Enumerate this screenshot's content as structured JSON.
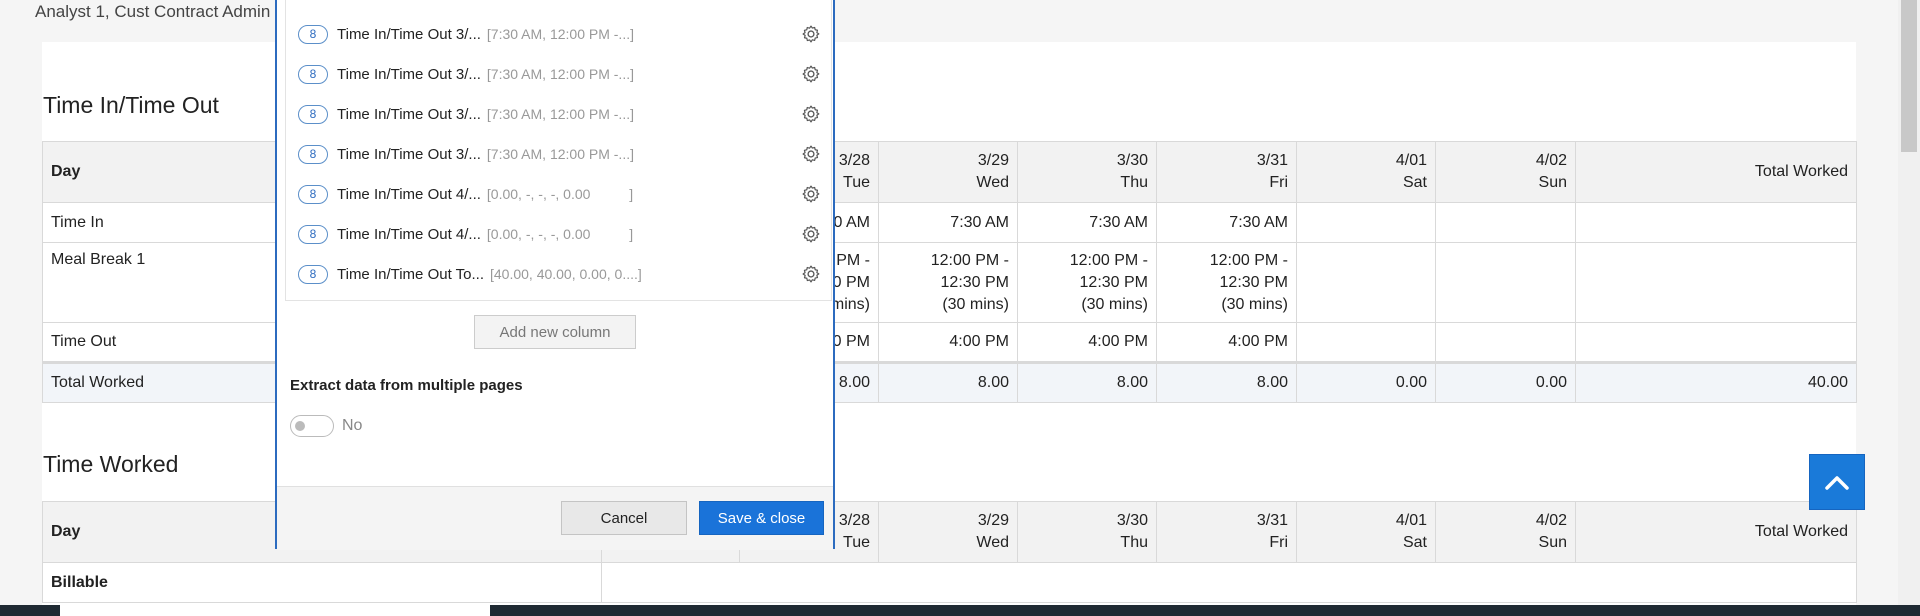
{
  "header": {
    "user_text": "Analyst 1, Cust Contract Admin"
  },
  "time_in_out": {
    "title": "Time In/Time Out",
    "columns": [
      {
        "date": "",
        "day": ""
      },
      {
        "date": "3/28",
        "day": "Tue"
      },
      {
        "date": "3/29",
        "day": "Wed"
      },
      {
        "date": "3/30",
        "day": "Thu"
      },
      {
        "date": "3/31",
        "day": "Fri"
      },
      {
        "date": "4/01",
        "day": "Sat"
      },
      {
        "date": "4/02",
        "day": "Sun"
      }
    ],
    "day_header": "Day",
    "total_header": "Total Worked",
    "rows": {
      "time_in": {
        "label": "Time In",
        "cells": [
          "",
          "0 AM",
          "7:30 AM",
          "7:30 AM",
          "7:30 AM",
          "",
          "",
          ""
        ]
      },
      "meal_break": {
        "label": "Meal Break 1",
        "cells": [
          [
            "",
            "",
            ""
          ],
          [
            "PM -",
            "0 PM",
            "mins)"
          ],
          [
            "12:00 PM -",
            "12:30 PM",
            "(30 mins)"
          ],
          [
            "12:00 PM -",
            "12:30 PM",
            "(30 mins)"
          ],
          [
            "12:00 PM -",
            "12:30 PM",
            "(30 mins)"
          ],
          [
            "",
            "",
            ""
          ],
          [
            "",
            "",
            ""
          ],
          [
            "",
            "",
            ""
          ]
        ]
      },
      "time_out": {
        "label": "Time Out",
        "cells": [
          "",
          "0 PM",
          "4:00 PM",
          "4:00 PM",
          "4:00 PM",
          "",
          "",
          ""
        ]
      },
      "total": {
        "label": "Total Worked",
        "cells": [
          "",
          "8.00",
          "8.00",
          "8.00",
          "8.00",
          "0.00",
          "0.00",
          "40.00"
        ]
      }
    }
  },
  "time_worked": {
    "title": "Time Worked",
    "day_header": "Day",
    "total_header": "Total Worked",
    "billable_label": "Billable"
  },
  "modal": {
    "rows": [
      {
        "badge": "8",
        "name": "Time In/Time Out 3/...",
        "meta": "[7:30 AM, 12:00 PM -...]"
      },
      {
        "badge": "8",
        "name": "Time In/Time Out 3/...",
        "meta": "[7:30 AM, 12:00 PM -...]"
      },
      {
        "badge": "8",
        "name": "Time In/Time Out 3/...",
        "meta": "[7:30 AM, 12:00 PM -...]"
      },
      {
        "badge": "8",
        "name": "Time In/Time Out 3/...",
        "meta": "[7:30 AM, 12:00 PM -...]"
      },
      {
        "badge": "8",
        "name": "Time In/Time Out 4/...",
        "meta": "[0.00, -, -, -, 0.00          ]"
      },
      {
        "badge": "8",
        "name": "Time In/Time Out 4/...",
        "meta": "[0.00, -, -, -, 0.00          ]"
      },
      {
        "badge": "8",
        "name": "Time In/Time Out To...",
        "meta": "[40.00, 40.00, 0.00, 0....]"
      }
    ],
    "add_column_label": "Add new column",
    "extract_label": "Extract data from multiple pages",
    "toggle_value": "No",
    "cancel_label": "Cancel",
    "save_label": "Save & close"
  },
  "colors": {
    "accent": "#1a73d9",
    "modal_border": "#2c6bbf"
  }
}
